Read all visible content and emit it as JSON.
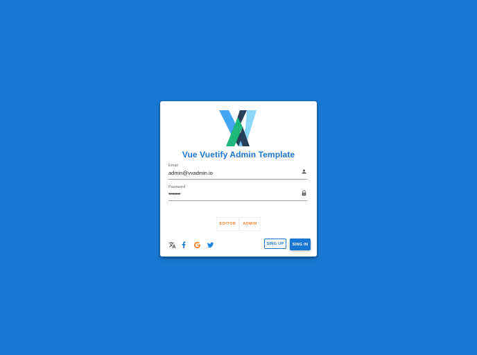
{
  "app": {
    "title": "Vue Vuetify Admin Template"
  },
  "login": {
    "email": {
      "label": "Email",
      "value": "admin@vvadmin.io",
      "icon": "account-icon"
    },
    "password": {
      "label": "Password",
      "value": "••••••••",
      "icon": "lock-icon"
    },
    "roles": [
      {
        "label": "EDITOR"
      },
      {
        "label": "ADMIN"
      }
    ],
    "social": [
      {
        "icon": "translate-icon"
      },
      {
        "icon": "facebook-icon"
      },
      {
        "icon": "google-icon"
      },
      {
        "icon": "twitter-icon"
      }
    ],
    "signup_label": "SING UP",
    "signin_label": "SING IN"
  },
  "colors": {
    "background": "#1976d2",
    "primary": "#1976d2",
    "role_accent": "#ff7f24",
    "logo_blue_light": "#4fc3f7",
    "logo_green": "#1db87a",
    "logo_navy": "#27405a"
  }
}
